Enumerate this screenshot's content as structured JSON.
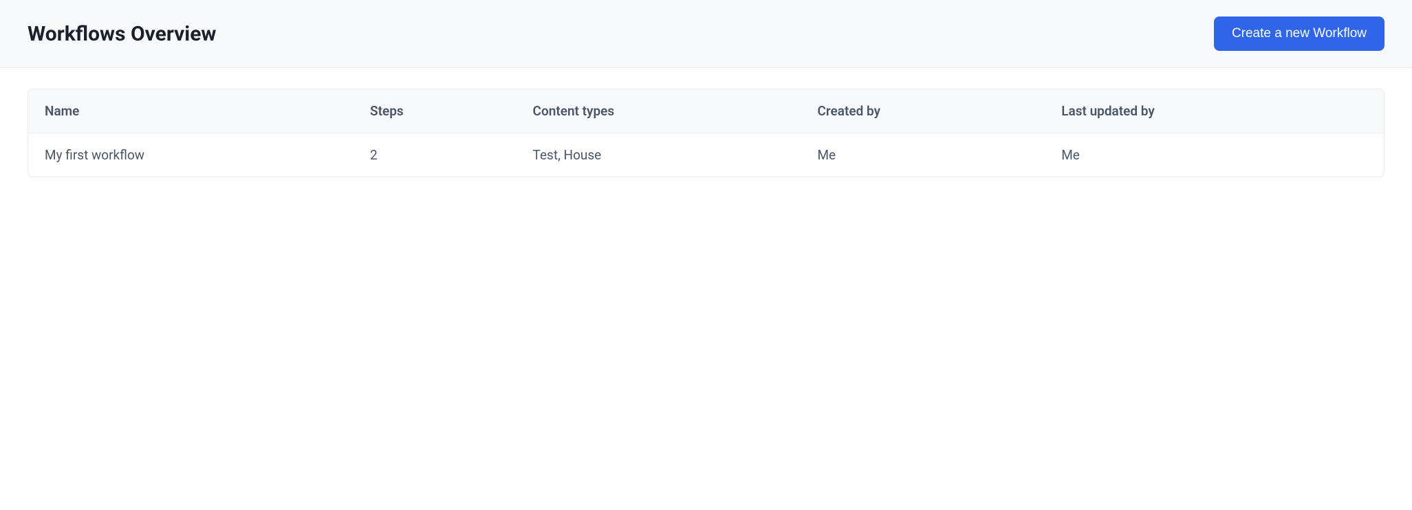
{
  "header": {
    "title": "Workflows Overview",
    "create_button_label": "Create a new Workflow"
  },
  "table": {
    "columns": [
      "Name",
      "Steps",
      "Content types",
      "Created by",
      "Last updated by"
    ],
    "rows": [
      {
        "name": "My first workflow",
        "steps": "2",
        "content_types": "Test, House",
        "created_by": "Me",
        "last_updated_by": "Me"
      }
    ]
  }
}
